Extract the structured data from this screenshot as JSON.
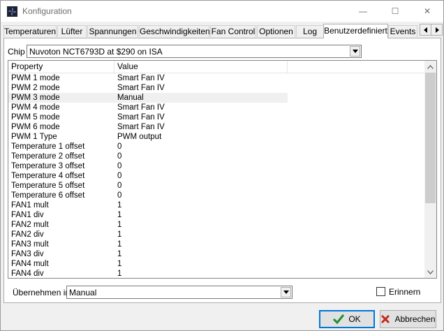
{
  "window": {
    "title": "Konfiguration",
    "controls": {
      "minimize": "—",
      "maximize": "☐",
      "close": "✕"
    }
  },
  "tabs": [
    "Temperaturen",
    "Lüfter",
    "Spannungen",
    "Geschwindigkeiten",
    "Fan Control",
    "Optionen",
    "Log",
    "Benutzerdefiniert",
    "Events"
  ],
  "active_tab": "Benutzerdefiniert",
  "chip": {
    "label": "Chip",
    "value": "Nuvoton NCT6793D at $290 on ISA"
  },
  "table": {
    "headers": {
      "property": "Property",
      "value": "Value"
    },
    "rows": [
      {
        "property": "PWM 1 mode",
        "value": "Smart Fan IV"
      },
      {
        "property": "PWM 2 mode",
        "value": "Smart Fan IV"
      },
      {
        "property": "PWM 3 mode",
        "value": "Manual"
      },
      {
        "property": "PWM 4 mode",
        "value": "Smart Fan IV"
      },
      {
        "property": "PWM 5 mode",
        "value": "Smart Fan IV"
      },
      {
        "property": "PWM 6 mode",
        "value": "Smart Fan IV"
      },
      {
        "property": "PWM 1 Type",
        "value": "PWM output"
      },
      {
        "property": "Temperature 1 offset",
        "value": "0"
      },
      {
        "property": "Temperature 2 offset",
        "value": "0"
      },
      {
        "property": "Temperature 3 offset",
        "value": "0"
      },
      {
        "property": "Temperature 4 offset",
        "value": "0"
      },
      {
        "property": "Temperature 5 offset",
        "value": "0"
      },
      {
        "property": "Temperature 6 offset",
        "value": "0"
      },
      {
        "property": "FAN1 mult",
        "value": "1"
      },
      {
        "property": "FAN1 div",
        "value": "1"
      },
      {
        "property": "FAN2 mult",
        "value": "1"
      },
      {
        "property": "FAN2 div",
        "value": "1"
      },
      {
        "property": "FAN3 mult",
        "value": "1"
      },
      {
        "property": "FAN3 div",
        "value": "1"
      },
      {
        "property": "FAN4 mult",
        "value": "1"
      },
      {
        "property": "FAN4 div",
        "value": "1"
      }
    ],
    "selected_row": 2
  },
  "apply": {
    "label": "Übernehmen in",
    "value": "Manual"
  },
  "remember": {
    "label": "Erinnern",
    "checked": false
  },
  "buttons": {
    "ok": "OK",
    "cancel": "Abbrechen"
  },
  "colors": {
    "ok_check": "#1e8f2f",
    "cancel_x": "#c42b1c",
    "focus_border": "#0078d7"
  }
}
